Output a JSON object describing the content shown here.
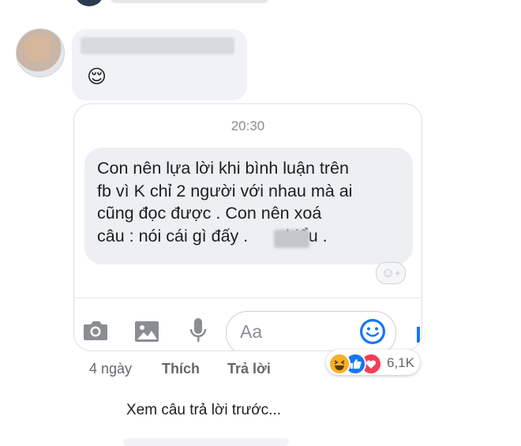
{
  "comment": {
    "emoji": "😌"
  },
  "card": {
    "time": "20:30",
    "message_lines": [
      "Con nên lựa lời khi bình luận trên",
      "fb vì K chỉ 2 người với nhau mà ai",
      "cũng đọc được . Con nên xoá",
      "câu : nói cái gì đấy .        hiểu ."
    ],
    "react_plus": "+",
    "input_placeholder": "Aa"
  },
  "actions": {
    "time_ago": "4 ngày",
    "like": "Thích",
    "reply": "Trả lời"
  },
  "reactions": {
    "count": "6,1K",
    "types": [
      "haha",
      "like",
      "love"
    ],
    "colors": {
      "haha": "#f7b125",
      "like": "#1877f2",
      "love": "#f33e58"
    }
  },
  "see_previous": "Xem câu trả lời trước...",
  "icons": [
    "camera-icon",
    "photo-icon",
    "mic-icon",
    "smile-icon"
  ]
}
